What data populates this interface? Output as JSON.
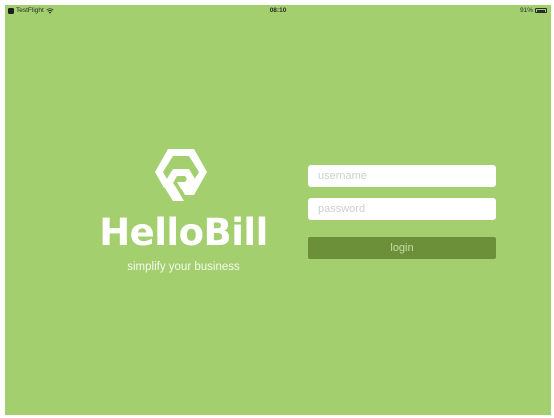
{
  "status_bar": {
    "app_name": "TestFlight",
    "time": "08:10",
    "battery": "91%",
    "icons": [
      "testflight-app-icon",
      "wifi-icon",
      "battery-icon"
    ]
  },
  "brand": {
    "name": "HelloBill",
    "tagline": "simplify your business",
    "logo_icon": "hellobill-hexagon-logo"
  },
  "login_form": {
    "username_placeholder": "username",
    "username_value": "",
    "password_placeholder": "password",
    "password_value": "",
    "login_label": "login"
  },
  "colors": {
    "background": "#a3cf6e",
    "button": "#6c8f3a",
    "button_text": "#c5dfa6",
    "input_background": "#ffffff",
    "brand_text": "#ffffff"
  }
}
